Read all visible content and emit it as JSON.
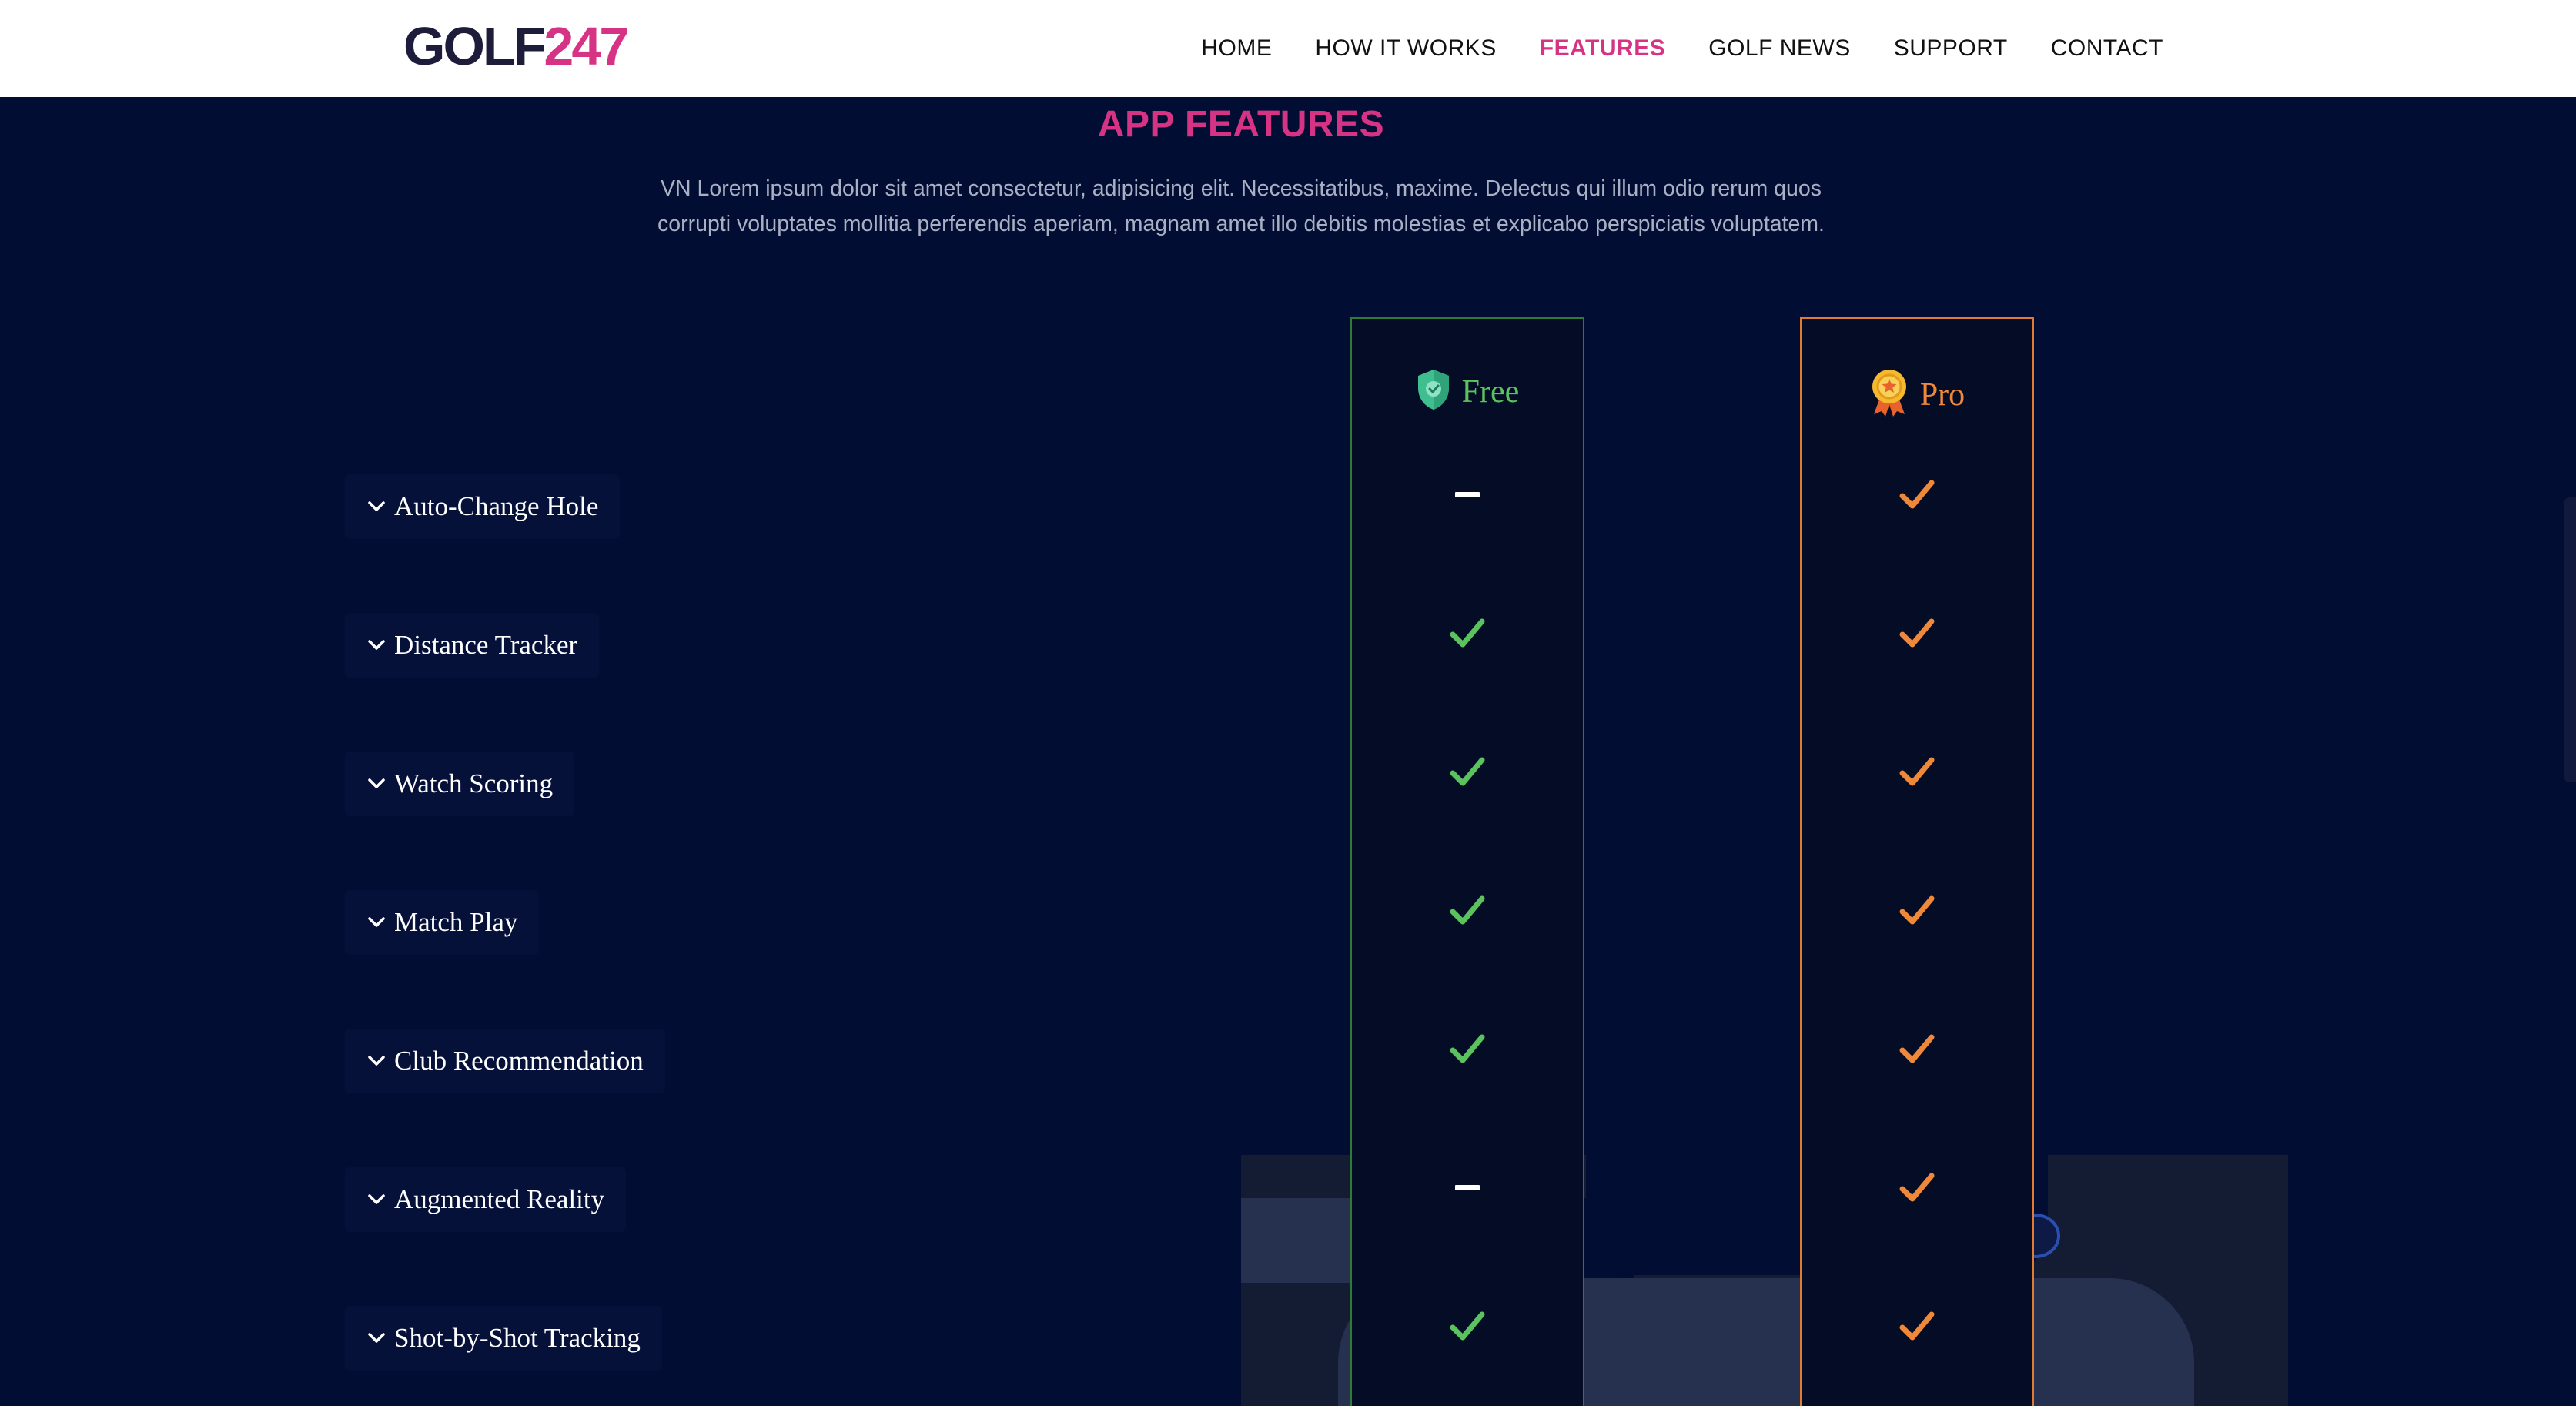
{
  "header": {
    "logo": {
      "left": "GOLF",
      "right": "247"
    },
    "nav": [
      {
        "label": "HOME",
        "active": false
      },
      {
        "label": "HOW IT WORKS",
        "active": false
      },
      {
        "label": "FEATURES",
        "active": true
      },
      {
        "label": "GOLF NEWS",
        "active": false
      },
      {
        "label": "SUPPORT",
        "active": false
      },
      {
        "label": "CONTACT",
        "active": false
      }
    ]
  },
  "section": {
    "title": "APP FEATURES",
    "description_line1": "VN Lorem ipsum dolor sit amet consectetur, adipisicing elit. Necessitatibus, maxime. Delectus qui illum odio rerum quos",
    "description_line2": "corrupti voluptates mollitia perferendis aperiam, magnam amet illo debitis molestias et explicabo perspiciatis voluptatem."
  },
  "plans": {
    "free": {
      "name": "Free",
      "icon": "shield-check-icon",
      "color": "#5ac35e"
    },
    "pro": {
      "name": "Pro",
      "icon": "award-medal-icon",
      "color": "#f0883a"
    }
  },
  "features": [
    {
      "label": "Auto-Change Hole",
      "free": false,
      "pro": true
    },
    {
      "label": "Distance Tracker",
      "free": true,
      "pro": true
    },
    {
      "label": "Watch Scoring",
      "free": true,
      "pro": true
    },
    {
      "label": "Match Play",
      "free": true,
      "pro": true
    },
    {
      "label": "Club Recommendation",
      "free": true,
      "pro": true
    },
    {
      "label": "Augmented Reality",
      "free": false,
      "pro": true
    },
    {
      "label": "Shot-by-Shot Tracking",
      "free": true,
      "pro": true
    }
  ],
  "colors": {
    "accent": "#d63384",
    "background": "#020d33",
    "free_check": "#5ac35e",
    "pro_check": "#f0883a"
  }
}
